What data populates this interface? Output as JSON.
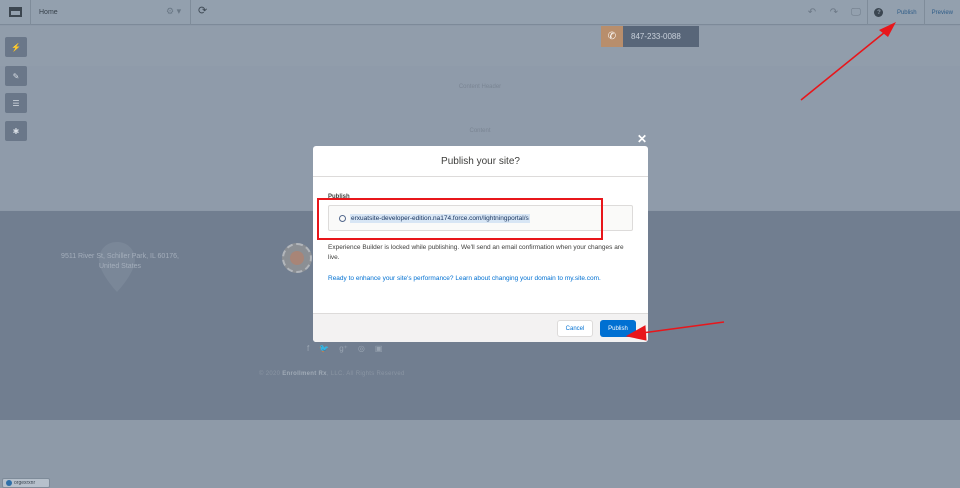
{
  "toolbar": {
    "page_name": "Home",
    "gear_dropdown": "⚙ ▾",
    "refresh": "⟳",
    "help": "?",
    "publish_label": "Publish",
    "preview_label": "Preview"
  },
  "site": {
    "phone": "847-233-0088",
    "content_header": "Content Header",
    "content": "Content",
    "address_line1": "9511 River St, Schiller Park, IL 60176,",
    "address_line2": "United States",
    "social": [
      "f",
      "🐦",
      "g⁺",
      "◎",
      "▣"
    ],
    "copyright_prefix": "© 2020 ",
    "copyright_brand": "Enrollment Rx",
    "copyright_suffix": ", LLC. All Rights Reserved",
    "org_tag": "orgexrxnr"
  },
  "modal": {
    "title": "Publish your site?",
    "section_label": "Publish",
    "url": "erxuatsite-developer-edition.na174.force.com/lightningportal/s",
    "info": "Experience Builder is locked while publishing. We'll send an email confirmation when your changes are live.",
    "link": "Ready to enhance your site's performance? Learn about changing your domain to my.site.com.",
    "cancel_label": "Cancel",
    "publish_label": "Publish",
    "close": "✕"
  },
  "colors": {
    "annotation_red": "#e8161b",
    "brand_blue": "#0070d2"
  }
}
